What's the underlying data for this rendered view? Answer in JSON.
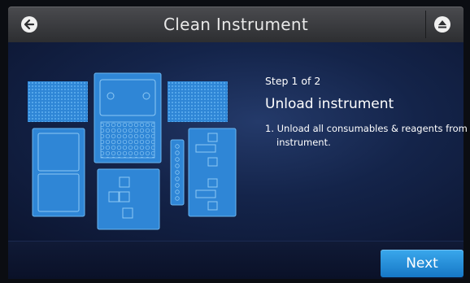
{
  "header": {
    "title": "Clean Instrument",
    "back_icon": "back-arrow-icon",
    "eject_icon": "eject-icon"
  },
  "content": {
    "step_indicator": "Step 1 of 2",
    "heading": "Unload instrument",
    "instruction": "1. Unload all consumables & reagents from instrument."
  },
  "footer": {
    "next_label": "Next"
  },
  "colors": {
    "accent": "#2a90dc",
    "consumable": "#2f86d6"
  }
}
